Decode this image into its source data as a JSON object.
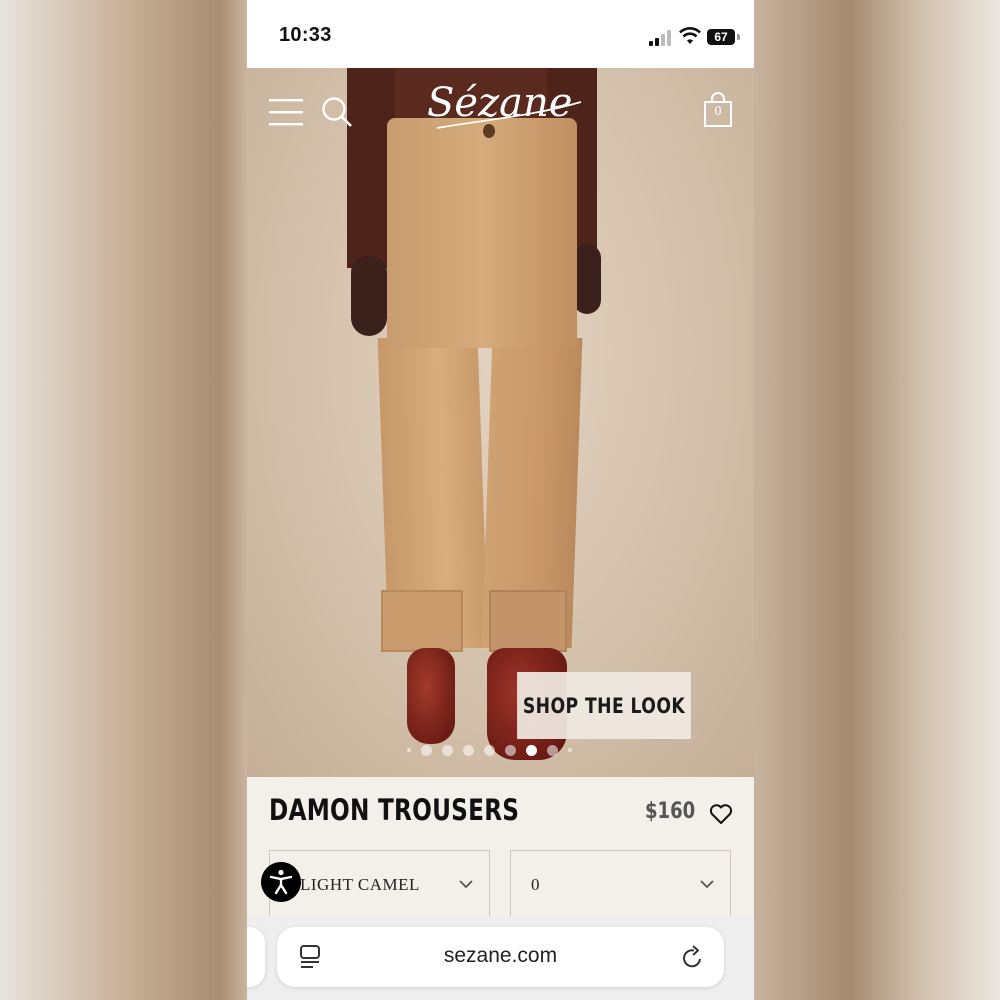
{
  "status_bar": {
    "time": "10:33",
    "battery": "67"
  },
  "header": {
    "logo": "Sézane",
    "bag_count": "0"
  },
  "hero": {
    "cta_label": "SHOP THE LOOK",
    "carousel": {
      "slides": 7,
      "active_index": 5
    }
  },
  "product": {
    "name": "DAMON TROUSERS",
    "price": "$160",
    "color_select": {
      "value": "LIGHT CAMEL"
    },
    "size_select": {
      "value": "0"
    }
  },
  "browser": {
    "url": "sezane.com"
  },
  "icons": [
    "menu-icon",
    "search-icon",
    "bag-icon",
    "heart-icon",
    "chevron-down-icon",
    "accessibility-icon",
    "tabs-icon",
    "reload-icon",
    "signal-icon",
    "wifi-icon",
    "battery-icon"
  ]
}
